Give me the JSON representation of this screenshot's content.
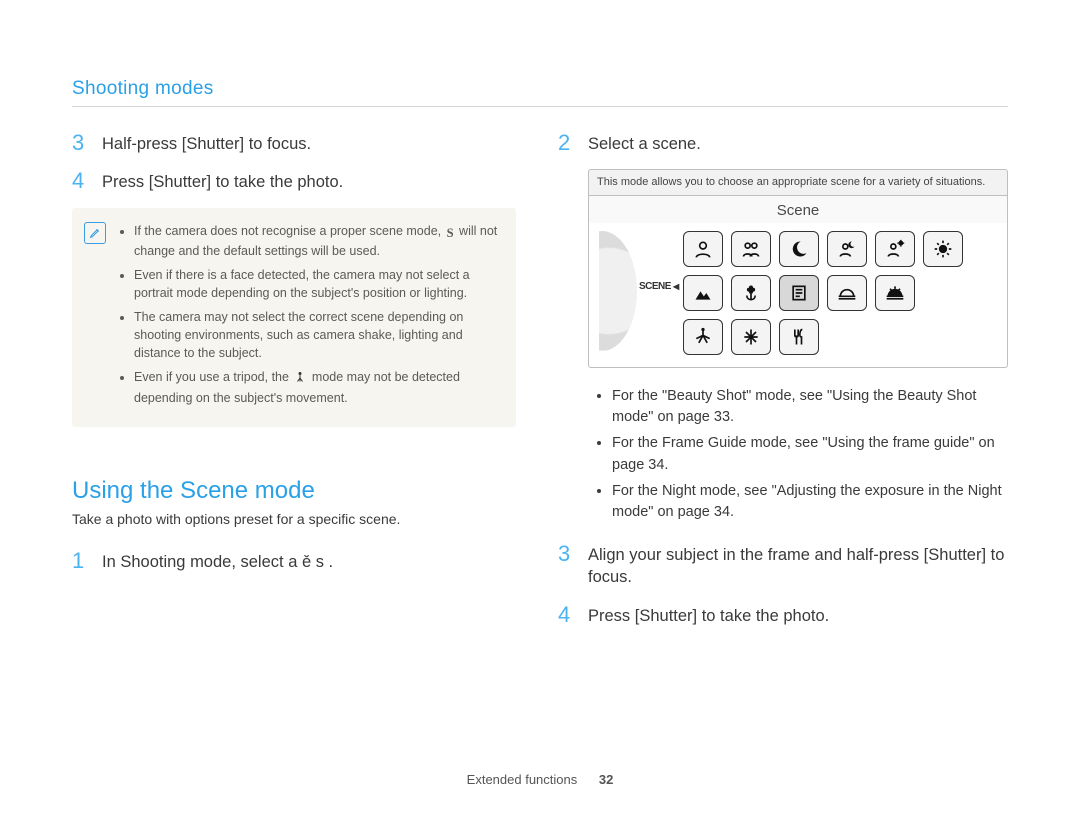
{
  "header": {
    "breadcrumb": "Shooting modes"
  },
  "left": {
    "steps": [
      {
        "n": "3",
        "text": "Half-press [Shutter] to focus."
      },
      {
        "n": "4",
        "text": "Press [Shutter] to take the photo."
      }
    ],
    "note_icon": "pencil-note-icon",
    "note_items": [
      {
        "pre": "If the camera does not recognise a proper scene mode, ",
        "glyph": "S",
        "post": " will not change and the default settings will be used."
      },
      {
        "pre": "Even if there is a face detected, the camera may not select a portrait mode depending on the subject's position or lighting.",
        "glyph": "",
        "post": ""
      },
      {
        "pre": "The camera may not select the correct scene depending on shooting environments, such as camera shake, lighting and distance to the subject.",
        "glyph": "",
        "post": ""
      },
      {
        "pre": "Even if you use a tripod, the ",
        "glyph": "tripod-person",
        "post": " mode may not be detected depending on the subject's movement."
      }
    ],
    "section_title": "Using the Scene mode",
    "section_sub": "Take a photo with options preset for a specific scene.",
    "step1": {
      "n": "1",
      "text": "In Shooting mode, select a  ě  s  ."
    }
  },
  "right": {
    "step2": {
      "n": "2",
      "text": "Select a scene."
    },
    "scene_panel": {
      "tip": "This mode allows you to choose an appropriate scene for a variety of situations.",
      "title": "Scene",
      "dial_label": "SCENE",
      "icons": [
        "portrait-icon",
        "children-icon",
        "night-moon-icon",
        "night-portrait-icon",
        "backlight-portrait-icon",
        "backlight-icon",
        "landscape-icon",
        "closeup-flower-icon",
        "text-icon",
        "sunset-icon",
        "dawn-icon",
        "",
        "fireworks-icon",
        "beach-snow-icon",
        "food-icon",
        "",
        "",
        ""
      ]
    },
    "refs": [
      "For the \"Beauty Shot\" mode, see \"Using the Beauty Shot mode\" on page 33.",
      "For the Frame Guide mode, see \"Using the frame guide\" on page 34.",
      "For the Night mode, see \"Adjusting the exposure in the Night mode\" on page 34."
    ],
    "step3": {
      "n": "3",
      "text": "Align your subject in the frame and half-press [Shutter] to focus."
    },
    "step4": {
      "n": "4",
      "text": "Press [Shutter] to take the photo."
    }
  },
  "footer": {
    "section": "Extended functions",
    "page": "32"
  },
  "glyph_svgs": {
    "S": "S",
    "tripod-person": "✶"
  }
}
